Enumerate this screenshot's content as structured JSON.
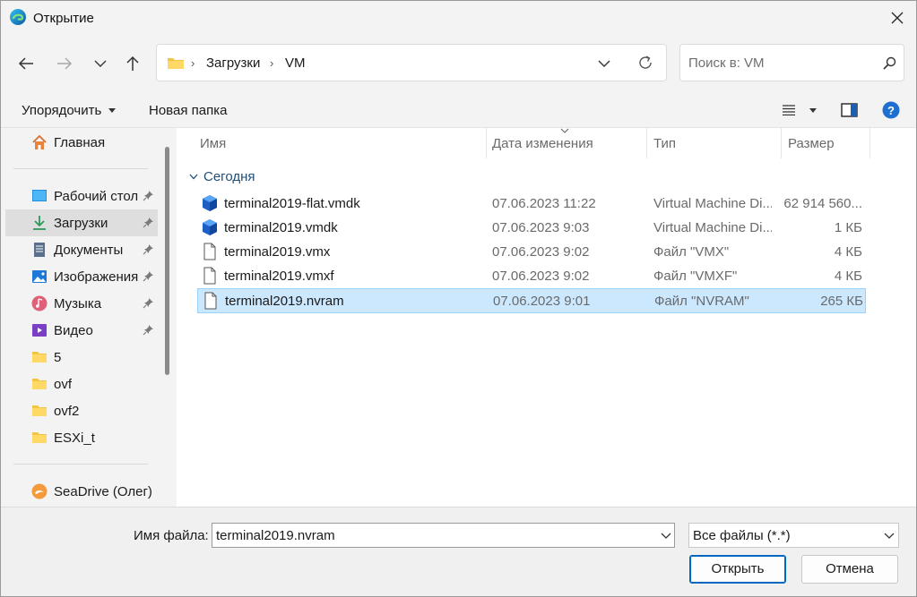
{
  "window": {
    "title": "Открытие"
  },
  "nav": {
    "breadcrumb": [
      "Загрузки",
      "VM"
    ],
    "search_placeholder": "Поиск в: VM"
  },
  "toolbar": {
    "organize_label": "Упорядочить",
    "new_folder_label": "Новая папка"
  },
  "sidebar": {
    "home_label": "Главная",
    "items": [
      {
        "label": "Рабочий стол",
        "icon": "desktop-icon",
        "pinned": true
      },
      {
        "label": "Загрузки",
        "icon": "download-icon",
        "pinned": true,
        "selected": true
      },
      {
        "label": "Документы",
        "icon": "documents-icon",
        "pinned": true
      },
      {
        "label": "Изображения",
        "icon": "pictures-icon",
        "pinned": true
      },
      {
        "label": "Музыка",
        "icon": "music-icon",
        "pinned": true
      },
      {
        "label": "Видео",
        "icon": "video-icon",
        "pinned": true
      },
      {
        "label": "5",
        "icon": "folder-icon"
      },
      {
        "label": "ovf",
        "icon": "folder-icon"
      },
      {
        "label": "ovf2",
        "icon": "folder-icon"
      },
      {
        "label": "ESXi_t",
        "icon": "folder-icon"
      }
    ],
    "seadrive_label": "SeaDrive (Олег)"
  },
  "columns": {
    "name": "Имя",
    "date": "Дата изменения",
    "type": "Тип",
    "size": "Размер"
  },
  "group_label": "Сегодня",
  "files": [
    {
      "name": "terminal2019-flat.vmdk",
      "date": "07.06.2023 11:22",
      "type": "Virtual Machine Di...",
      "size": "62 914 560...",
      "icon": "vmdk-icon"
    },
    {
      "name": "terminal2019.vmdk",
      "date": "07.06.2023 9:03",
      "type": "Virtual Machine Di...",
      "size": "1 КБ",
      "icon": "vmdk-icon"
    },
    {
      "name": "terminal2019.vmx",
      "date": "07.06.2023 9:02",
      "type": "Файл \"VMX\"",
      "size": "4 КБ",
      "icon": "file-icon"
    },
    {
      "name": "terminal2019.vmxf",
      "date": "07.06.2023 9:02",
      "type": "Файл \"VMXF\"",
      "size": "4 КБ",
      "icon": "file-icon"
    },
    {
      "name": "terminal2019.nvram",
      "date": "07.06.2023 9:01",
      "type": "Файл \"NVRAM\"",
      "size": "265 КБ",
      "icon": "file-icon",
      "selected": true
    }
  ],
  "bottom": {
    "filename_label": "Имя файла:",
    "filename_value": "terminal2019.nvram",
    "filter_value": "Все файлы (*.*)",
    "open_label": "Открыть",
    "cancel_label": "Отмена"
  },
  "colors": {
    "accent": "#0067c0",
    "selection": "#cce8ff",
    "group_header": "#1f4e79"
  }
}
